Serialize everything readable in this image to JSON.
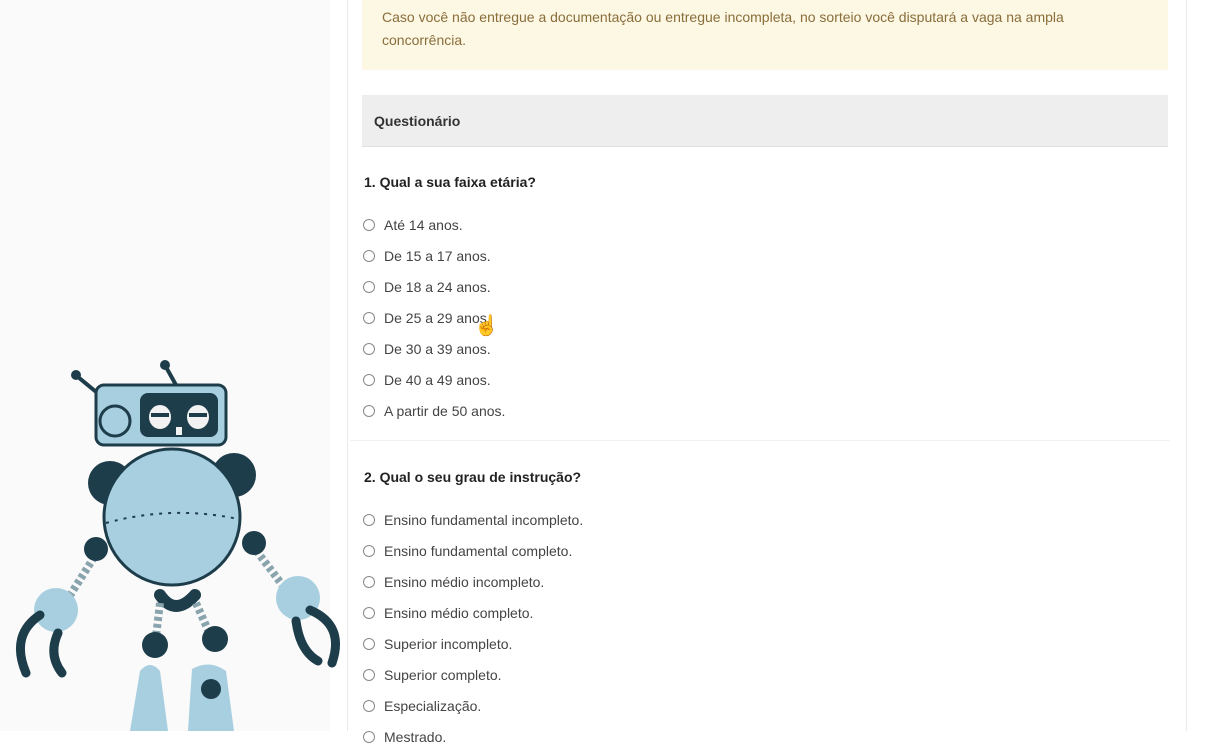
{
  "notice": {
    "text": "Caso você não entregue a documentação ou entregue incompleta, no sorteio você disputará a vaga na ampla concorrência."
  },
  "section": {
    "title": "Questionário"
  },
  "questions": [
    {
      "title": "1. Qual a sua faixa etária?",
      "options": [
        "Até 14 anos.",
        "De 15 a 17 anos.",
        "De 18 a 24 anos.",
        "De 25 a 29 anos.",
        "De 30 a 39 anos.",
        "De 40 a 49 anos.",
        "A partir de 50 anos."
      ]
    },
    {
      "title": "2. Qual o seu grau de instrução?",
      "options": [
        "Ensino fundamental incompleto.",
        "Ensino fundamental completo.",
        "Ensino médio incompleto.",
        "Ensino médio completo.",
        "Superior incompleto.",
        "Superior completo.",
        "Especialização.",
        "Mestrado."
      ]
    }
  ],
  "colors": {
    "notice_bg": "#fcf8e3",
    "notice_text": "#8a6d3b",
    "header_bg": "#eeeeee",
    "robot_light": "#a8cfe0",
    "robot_dark": "#1e3d4a"
  },
  "icons": {
    "cursor": "hand-pointer-icon",
    "mascot": "robot-mascot"
  }
}
